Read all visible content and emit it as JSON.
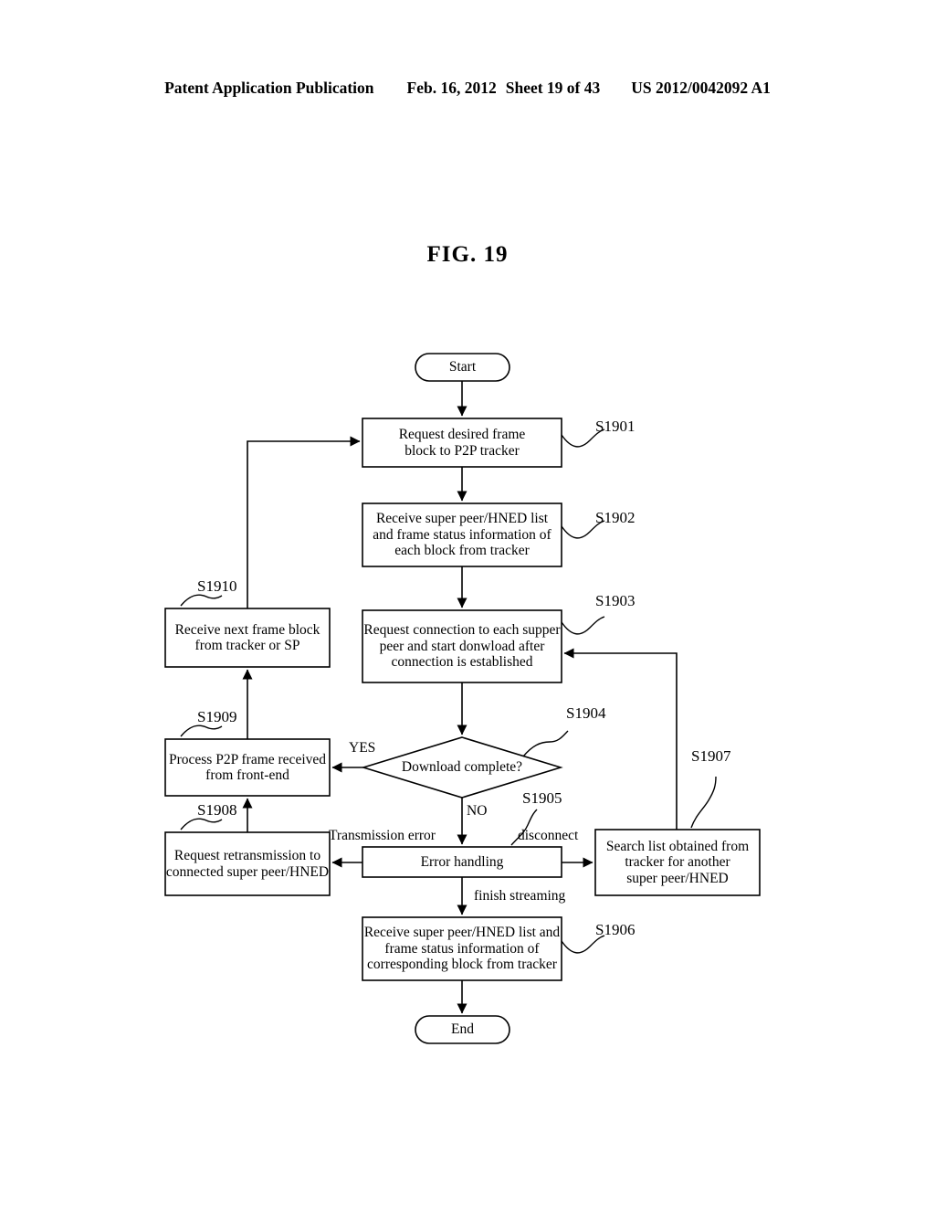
{
  "header": {
    "publication": "Patent Application Publication",
    "date": "Feb. 16, 2012",
    "sheet": "Sheet 19 of 43",
    "number": "US 2012/0042092 A1"
  },
  "figure": {
    "title": "FIG.  19"
  },
  "flowchart": {
    "terminals": {
      "start": "Start",
      "end": "End"
    },
    "nodes": [
      {
        "id": "S1901",
        "text": "Request desired frame\nblock to P2P tracker",
        "lines": [
          "Request desired frame",
          "block to P2P tracker"
        ],
        "shape": "process"
      },
      {
        "id": "S1902",
        "text": "Receive super peer/HNED list\nand frame status information of\neach block from tracker",
        "lines": [
          "Receive super peer/HNED list",
          "and frame status information of",
          "each block from tracker"
        ],
        "shape": "process"
      },
      {
        "id": "S1903",
        "text": "Request connection to each supper\npeer and start donwload after\nconnection is established",
        "lines": [
          "Request connection to each supper",
          "peer and start donwload after",
          "connection is established"
        ],
        "shape": "process"
      },
      {
        "id": "S1904",
        "text": "Download complete?",
        "lines": [
          "Download complete?"
        ],
        "shape": "decision"
      },
      {
        "id": "S1905",
        "text": "Error handling",
        "lines": [
          "Error handling"
        ],
        "shape": "process"
      },
      {
        "id": "S1906",
        "text": "Receive super peer/HNED list and\nframe status information of\ncorresponding block from tracker",
        "lines": [
          "Receive super peer/HNED list and",
          "frame status information of",
          "corresponding block from tracker"
        ],
        "shape": "process"
      },
      {
        "id": "S1907",
        "text": "Search list obtained from\ntracker for another\nsuper peer/HNED",
        "lines": [
          "Search list obtained from",
          "tracker for another",
          "super peer/HNED"
        ],
        "shape": "process"
      },
      {
        "id": "S1908",
        "text": "Request retransmission to\nconnected super peer/HNED",
        "lines": [
          "Request retransmission to",
          "connected super peer/HNED"
        ],
        "shape": "process"
      },
      {
        "id": "S1909",
        "text": "Process P2P frame received\nfrom front-end",
        "lines": [
          "Process P2P frame received",
          "from front-end"
        ],
        "shape": "process"
      },
      {
        "id": "S1910",
        "text": "Receive next frame block\nfrom tracker or SP",
        "lines": [
          "Receive next frame block",
          "from tracker or SP"
        ],
        "shape": "process"
      }
    ],
    "edge_labels": {
      "yes": "YES",
      "no": "NO",
      "transmission_error": "Transmission error",
      "disconnect": "disconnect",
      "finish_streaming": "finish streaming"
    },
    "step_ids": {
      "s1901": "S1901",
      "s1902": "S1902",
      "s1903": "S1903",
      "s1904": "S1904",
      "s1905": "S1905",
      "s1906": "S1906",
      "s1907": "S1907",
      "s1908": "S1908",
      "s1909": "S1909",
      "s1910": "S1910"
    },
    "colors": {
      "line": "#000000",
      "background": "#ffffff"
    }
  }
}
